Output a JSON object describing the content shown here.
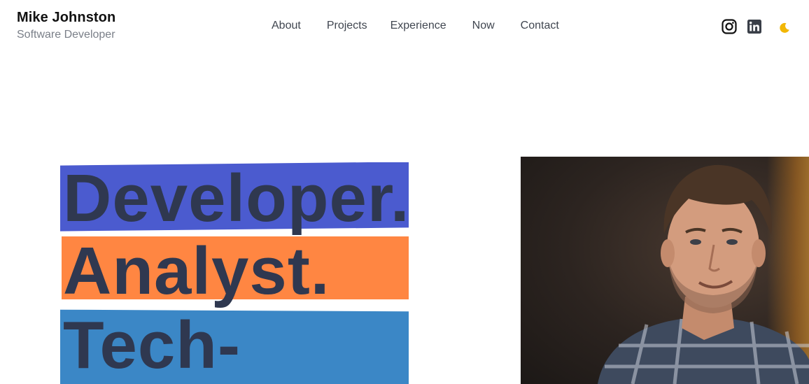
{
  "header": {
    "name": "Mike Johnston",
    "role": "Software Developer"
  },
  "nav": {
    "items": [
      "About",
      "Projects",
      "Experience",
      "Now",
      "Contact"
    ]
  },
  "social": {
    "icons": [
      "instagram-icon",
      "linkedin-icon",
      "moon-icon"
    ],
    "moon_color": "#f2b705"
  },
  "hero": {
    "words": [
      "Developer.",
      "Analyst.",
      "Tech-"
    ],
    "band_colors": [
      "#4b5bcf",
      "#ff8642",
      "#3b87c6"
    ],
    "text_color": "#2f3850"
  }
}
